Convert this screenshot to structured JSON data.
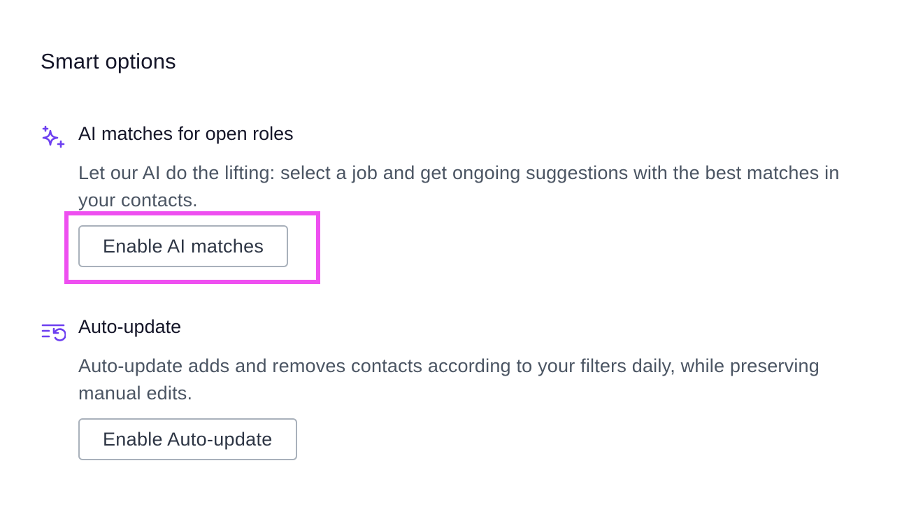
{
  "section": {
    "title": "Smart options"
  },
  "options": [
    {
      "icon": "sparkles-icon",
      "title": "AI matches for open roles",
      "description": "Let our AI do the lifting: select a job and get ongoing suggestions with the best matches in your contacts.",
      "button_label": "Enable AI matches"
    },
    {
      "icon": "list-refresh-icon",
      "title": "Auto-update",
      "description": "Auto-update adds and removes contacts according to your filters daily, while preserving manual edits.",
      "button_label": "Enable Auto-update"
    }
  ],
  "colors": {
    "accent_icon": "#6d3ff0",
    "highlight": "#ee4ff0",
    "button_border": "#a9b1bb",
    "body_text": "#4b5563",
    "heading_text": "#141528"
  }
}
